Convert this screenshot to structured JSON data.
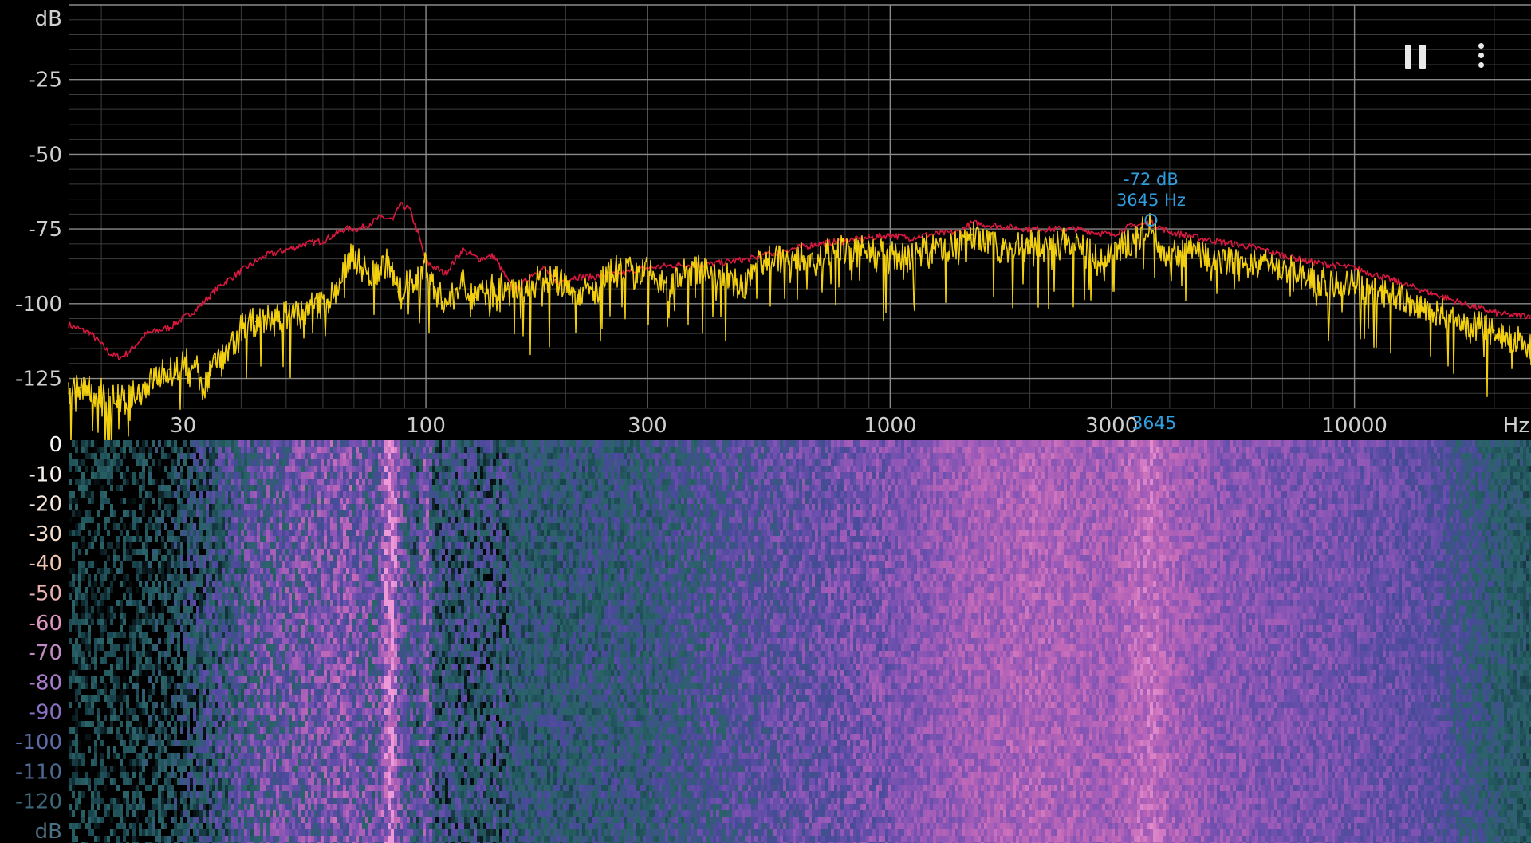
{
  "controls": {
    "pause_icon": "pause-icon",
    "menu_icon": "more-vertical-icon"
  },
  "chart_data": [
    {
      "type": "line",
      "scale": {
        "x": "log",
        "y": "linear"
      },
      "xlabel": "Hz",
      "ylabel": "dB",
      "xlim": [
        17,
        24000
      ],
      "ylim": [
        -135,
        0
      ],
      "x_ticks": [
        30,
        100,
        300,
        1000,
        3000,
        10000
      ],
      "x_tick_labels": [
        "30",
        "100",
        "300",
        "1000",
        "3000",
        "10000"
      ],
      "y_ticks": [
        -25,
        -50,
        -75,
        -100,
        -125
      ],
      "y_tick_labels": [
        "-25",
        "-50",
        "-75",
        "-100",
        "-125"
      ],
      "grid": true,
      "colors": {
        "peak_hold": "#d8183f",
        "live": "#f2d010",
        "cursor": "#2f9fe0",
        "grid_major": "#8a8a8a",
        "grid_minor": "#3c3c3c"
      },
      "series": [
        {
          "color": "#d8183f",
          "points": [
            [
              17,
              -107
            ],
            [
              19,
              -110
            ],
            [
              21,
              -117
            ],
            [
              22,
              -118
            ],
            [
              23,
              -116
            ],
            [
              25,
              -110
            ],
            [
              28,
              -108
            ],
            [
              32,
              -102
            ],
            [
              36,
              -94
            ],
            [
              40,
              -89
            ],
            [
              45,
              -84
            ],
            [
              50,
              -82
            ],
            [
              55,
              -80
            ],
            [
              60,
              -79
            ],
            [
              67,
              -75
            ],
            [
              72,
              -75
            ],
            [
              76,
              -73
            ],
            [
              80,
              -71
            ],
            [
              85,
              -72
            ],
            [
              88,
              -67
            ],
            [
              92,
              -68
            ],
            [
              96,
              -76
            ],
            [
              100,
              -86
            ],
            [
              110,
              -90
            ],
            [
              120,
              -82
            ],
            [
              130,
              -85
            ],
            [
              140,
              -84
            ],
            [
              155,
              -96
            ],
            [
              170,
              -90
            ],
            [
              180,
              -88
            ],
            [
              190,
              -93
            ],
            [
              210,
              -91
            ],
            [
              230,
              -91
            ],
            [
              260,
              -90
            ],
            [
              300,
              -88
            ],
            [
              350,
              -87
            ],
            [
              400,
              -87
            ],
            [
              500,
              -85
            ],
            [
              600,
              -82
            ],
            [
              700,
              -80
            ],
            [
              800,
              -79
            ],
            [
              900,
              -78
            ],
            [
              1000,
              -77
            ],
            [
              1100,
              -78
            ],
            [
              1200,
              -77
            ],
            [
              1400,
              -76
            ],
            [
              1500,
              -73
            ],
            [
              1700,
              -74
            ],
            [
              2000,
              -75
            ],
            [
              2500,
              -75
            ],
            [
              3000,
              -77
            ],
            [
              3300,
              -74
            ],
            [
              3645,
              -73
            ],
            [
              4000,
              -76
            ],
            [
              5000,
              -79
            ],
            [
              6000,
              -81
            ],
            [
              8000,
              -86
            ],
            [
              10000,
              -88
            ],
            [
              12000,
              -92
            ],
            [
              15000,
              -97
            ],
            [
              18000,
              -101
            ],
            [
              20000,
              -103
            ],
            [
              22000,
              -104
            ],
            [
              24000,
              -104
            ]
          ]
        },
        {
          "color": "#f2d010",
          "points": [
            [
              17,
              -130
            ],
            [
              18,
              -128
            ],
            [
              20,
              -130
            ],
            [
              22,
              -132
            ],
            [
              24,
              -130
            ],
            [
              26,
              -125
            ],
            [
              28,
              -122
            ],
            [
              30,
              -120
            ],
            [
              32,
              -119
            ],
            [
              33,
              -130
            ],
            [
              34,
              -126
            ],
            [
              35,
              -118
            ],
            [
              37,
              -118
            ],
            [
              40,
              -108
            ],
            [
              43,
              -106
            ],
            [
              47,
              -105
            ],
            [
              52,
              -103
            ],
            [
              55,
              -102
            ],
            [
              60,
              -100
            ],
            [
              64,
              -96
            ],
            [
              67,
              -88
            ],
            [
              69,
              -83
            ],
            [
              73,
              -88
            ],
            [
              77,
              -90
            ],
            [
              83,
              -86
            ],
            [
              87,
              -96
            ],
            [
              92,
              -93
            ],
            [
              96,
              -92
            ],
            [
              100,
              -86
            ],
            [
              104,
              -95
            ],
            [
              108,
              -98
            ],
            [
              112,
              -100
            ],
            [
              120,
              -92
            ],
            [
              128,
              -98
            ],
            [
              140,
              -94
            ],
            [
              150,
              -95
            ],
            [
              160,
              -97
            ],
            [
              175,
              -92
            ],
            [
              190,
              -92
            ],
            [
              210,
              -96
            ],
            [
              230,
              -96
            ],
            [
              260,
              -86
            ],
            [
              280,
              -90
            ],
            [
              300,
              -89
            ],
            [
              330,
              -95
            ],
            [
              360,
              -90
            ],
            [
              400,
              -88
            ],
            [
              450,
              -91
            ],
            [
              480,
              -95
            ],
            [
              520,
              -86
            ],
            [
              560,
              -84
            ],
            [
              600,
              -86
            ],
            [
              650,
              -84
            ],
            [
              700,
              -86
            ],
            [
              760,
              -80
            ],
            [
              820,
              -84
            ],
            [
              900,
              -81
            ],
            [
              1000,
              -84
            ],
            [
              1100,
              -84
            ],
            [
              1200,
              -82
            ],
            [
              1300,
              -82
            ],
            [
              1400,
              -80
            ],
            [
              1500,
              -77
            ],
            [
              1600,
              -80
            ],
            [
              1800,
              -82
            ],
            [
              2000,
              -79
            ],
            [
              2200,
              -82
            ],
            [
              2500,
              -78
            ],
            [
              2800,
              -86
            ],
            [
              3000,
              -85
            ],
            [
              3200,
              -80
            ],
            [
              3400,
              -78
            ],
            [
              3645,
              -72
            ],
            [
              3800,
              -80
            ],
            [
              4000,
              -84
            ],
            [
              4500,
              -82
            ],
            [
              5000,
              -86
            ],
            [
              5500,
              -85
            ],
            [
              6000,
              -87
            ],
            [
              6500,
              -86
            ],
            [
              7000,
              -88
            ],
            [
              8000,
              -91
            ],
            [
              9000,
              -94
            ],
            [
              10000,
              -93
            ],
            [
              11000,
              -95
            ],
            [
              12000,
              -97
            ],
            [
              14000,
              -101
            ],
            [
              16000,
              -104
            ],
            [
              18000,
              -107
            ],
            [
              20000,
              -109
            ],
            [
              22000,
              -112
            ],
            [
              24000,
              -114
            ]
          ]
        }
      ],
      "cursor": {
        "freq_hz": 3645,
        "level_db": -72,
        "label_db": "-72 dB",
        "label_hz": "3645 Hz",
        "axis_label": "3645"
      }
    },
    {
      "type": "heatmap",
      "scale": {
        "x": "log"
      },
      "xlim": [
        17,
        24000
      ],
      "yaxis_label": "dB",
      "y_ticks": [
        "0",
        "-10",
        "-20",
        "-30",
        "-40",
        "-50",
        "-60",
        "-70",
        "-80",
        "-90",
        "-100",
        "-110",
        "-120"
      ],
      "colors": [
        "#000000",
        "#1c4a54",
        "#2a6468",
        "#474a98",
        "#6c4fae",
        "#9a5ab8",
        "#c46ab8",
        "#ee9ad8"
      ],
      "y_tick_colors": [
        "#f8f8f8",
        "#f8f0ea",
        "#f6e8dc",
        "#f2dccc",
        "#eec6b2",
        "#e9b0b2",
        "#dc96c0",
        "#c48ac8",
        "#a87ccc",
        "#8a70c2",
        "#5f6aa8",
        "#4c6890",
        "#3e6878"
      ],
      "profile": [
        [
          17,
          0.02
        ],
        [
          22,
          0.03
        ],
        [
          28,
          0.1
        ],
        [
          35,
          0.32
        ],
        [
          45,
          0.5
        ],
        [
          55,
          0.55
        ],
        [
          65,
          0.62
        ],
        [
          72,
          0.58
        ],
        [
          78,
          0.48
        ],
        [
          84,
          0.92
        ],
        [
          88,
          0.55
        ],
        [
          96,
          0.32
        ],
        [
          100,
          0.68
        ],
        [
          104,
          0.3
        ],
        [
          130,
          0.28
        ],
        [
          200,
          0.3
        ],
        [
          300,
          0.34
        ],
        [
          500,
          0.48
        ],
        [
          800,
          0.58
        ],
        [
          1000,
          0.62
        ],
        [
          1500,
          0.74
        ],
        [
          2000,
          0.78
        ],
        [
          3000,
          0.74
        ],
        [
          3645,
          0.85
        ],
        [
          4000,
          0.76
        ],
        [
          5000,
          0.68
        ],
        [
          7000,
          0.62
        ],
        [
          10000,
          0.58
        ],
        [
          14000,
          0.52
        ],
        [
          20000,
          0.3
        ],
        [
          24000,
          0.22
        ]
      ]
    }
  ]
}
